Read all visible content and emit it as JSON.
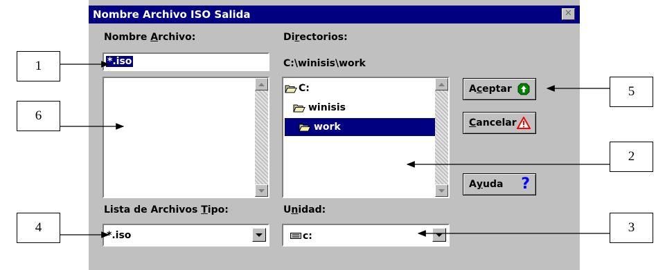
{
  "dialog": {
    "title": "Nombre Archivo ISO Salida",
    "close_icon": "close-icon"
  },
  "filename": {
    "label_pre": "Nombre ",
    "label_u": "A",
    "label_post": "rchivo:",
    "value": "*.iso"
  },
  "directories": {
    "label_pre": "Di",
    "label_u": "r",
    "label_post": "ectorios:",
    "current_path": "C:\\winisis\\work",
    "items": [
      {
        "label": "C:",
        "icon": "open-folder-icon",
        "selected": false
      },
      {
        "label": "winisis",
        "icon": "open-folder-icon",
        "selected": false
      },
      {
        "label": "work",
        "icon": "open-folder-icon",
        "selected": true
      }
    ]
  },
  "file_type": {
    "label_pre": "Lista de Archivos ",
    "label_u": "T",
    "label_post": "ipo:",
    "value": "*.iso"
  },
  "drive": {
    "label_pre": "U",
    "label_u": "n",
    "label_post": "idad:",
    "value": "c:",
    "icon": "drive-icon"
  },
  "buttons": {
    "accept": {
      "pre": "A",
      "u": "c",
      "post": "eptar",
      "icon": "green-go-icon"
    },
    "cancel": {
      "pre": "",
      "u": "C",
      "post": "ancelar",
      "icon": "warning-triangle-icon"
    },
    "help": {
      "pre": "A",
      "u": "y",
      "post": "uda",
      "icon": "question-mark-icon"
    }
  },
  "callouts": [
    "1",
    "2",
    "3",
    "4",
    "5",
    "6"
  ],
  "colors": {
    "title_bar": "#000080",
    "dialog_bg": "#c0c0c0",
    "selection": "#000080",
    "accept_icon": "#008000",
    "cancel_icon": "#ff0000",
    "help_icon": "#0000ff"
  }
}
